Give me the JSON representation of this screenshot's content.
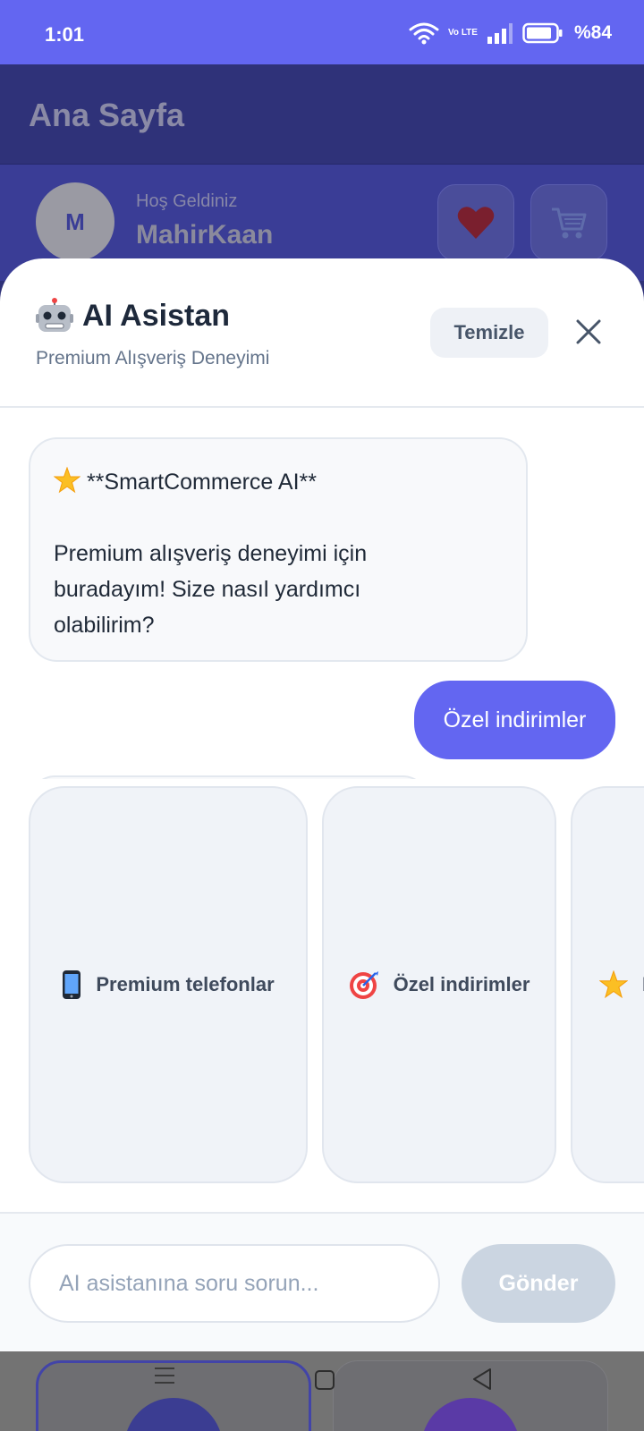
{
  "status_bar": {
    "time": "1:01",
    "network": "Vo LTE",
    "battery_percent": "%84",
    "battery_level": 0.84
  },
  "header": {
    "title": "Ana Sayfa"
  },
  "welcome": {
    "avatar_initial": "M",
    "greeting": "Hoş Geldiniz",
    "username": "MahirKaan",
    "favorites_icon": "heart-icon",
    "cart_icon": "cart-icon"
  },
  "assistant": {
    "icon": "robot-icon",
    "title": "AI Asistan",
    "subtitle": "Premium Alışveriş Deneyimi",
    "clear_label": "Temizle",
    "close_icon": "close-icon"
  },
  "messages": {
    "ai_first": {
      "icon": "star-icon",
      "heading": "**SmartCommerce AI**",
      "line1": "Premium alışveriş deneyimi için",
      "line2": "buradayım! Size nasıl yardımcı",
      "line3": "olabilirim?"
    },
    "user_first": "Özel indirimler"
  },
  "suggestions": [
    {
      "icon": "phone-icon",
      "label": "Premium telefonlar"
    },
    {
      "icon": "target-icon",
      "label": "Özel indirimler"
    },
    {
      "icon": "star-icon",
      "label": "E"
    }
  ],
  "input": {
    "placeholder": "AI asistanına soru sorun...",
    "value": "",
    "send_label": "Gönder"
  },
  "colors": {
    "primary": "#6366f1",
    "header_bg": "#2f3279",
    "send_disabled": "#cbd5e1"
  }
}
